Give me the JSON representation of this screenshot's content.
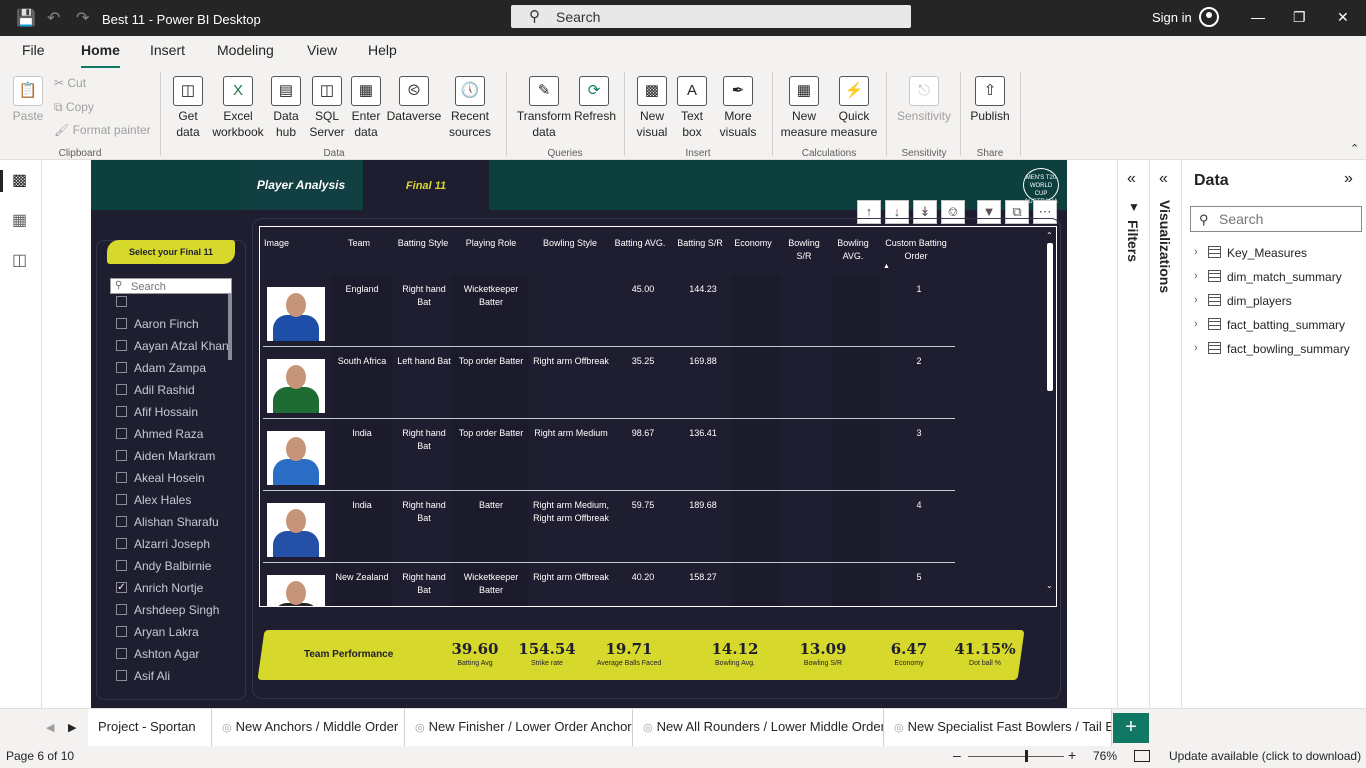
{
  "titlebar": {
    "title": "Best 11 - Power BI Desktop",
    "search_label": "Search",
    "signin_label": "Sign in"
  },
  "menu": [
    "File",
    "Home",
    "Insert",
    "Modeling",
    "View",
    "Help"
  ],
  "ribbon": {
    "clipboard": {
      "paste": "Paste",
      "cut": "Cut",
      "copy": "Copy",
      "format_painter": "Format painter",
      "group": "Clipboard"
    },
    "data": {
      "get_data": "Get data",
      "excel": "Excel workbook",
      "data_hub": "Data hub",
      "sql": "SQL Server",
      "enter": "Enter data",
      "dataverse": "Dataverse",
      "recent": "Recent sources",
      "group": "Data"
    },
    "queries": {
      "transform": "Transform data",
      "refresh": "Refresh",
      "group": "Queries"
    },
    "insert": {
      "new_visual": "New visual",
      "text_box": "Text box",
      "more_visuals": "More visuals",
      "group": "Insert"
    },
    "calculations": {
      "new_measure": "New measure",
      "quick_measure": "Quick measure",
      "group": "Calculations"
    },
    "sensitivity": {
      "label": "Sensitivity",
      "group": "Sensitivity"
    },
    "share": {
      "publish": "Publish",
      "group": "Share"
    }
  },
  "report": {
    "tabs": {
      "player_analysis": "Player Analysis",
      "final11": "Final 11"
    },
    "logo_text": "MEN'S T20 WORLD CUP AUSTRALIA 2022",
    "slicer": {
      "title": "Select your Final 11",
      "search_placeholder": "Search",
      "items": [
        {
          "name": "",
          "checked": false
        },
        {
          "name": "Aaron Finch",
          "checked": false
        },
        {
          "name": "Aayan Afzal Khan",
          "checked": false
        },
        {
          "name": "Adam Zampa",
          "checked": false
        },
        {
          "name": "Adil Rashid",
          "checked": false
        },
        {
          "name": "Afif Hossain",
          "checked": false
        },
        {
          "name": "Ahmed Raza",
          "checked": false
        },
        {
          "name": "Aiden Markram",
          "checked": false
        },
        {
          "name": "Akeal Hosein",
          "checked": false
        },
        {
          "name": "Alex Hales",
          "checked": false
        },
        {
          "name": "Alishan Sharafu",
          "checked": false
        },
        {
          "name": "Alzarri Joseph",
          "checked": false
        },
        {
          "name": "Andy Balbirnie",
          "checked": false
        },
        {
          "name": "Anrich Nortje",
          "checked": true
        },
        {
          "name": "Arshdeep Singh",
          "checked": false
        },
        {
          "name": "Aryan Lakra",
          "checked": false
        },
        {
          "name": "Ashton Agar",
          "checked": false
        },
        {
          "name": "Asif Ali",
          "checked": false
        }
      ]
    },
    "table": {
      "headers": [
        "Image",
        "Team",
        "Batting Style",
        "Playing Role",
        "Bowling Style",
        "Batting AVG.",
        "Batting S/R",
        "Economy",
        "Bowling S/R",
        "Bowling AVG.",
        "Custom Batting Order"
      ],
      "rows": [
        {
          "team": "England",
          "batting_style": "Right hand Bat",
          "role": "Wicketkeeper Batter",
          "bowling_style": "",
          "bat_avg": "45.00",
          "bat_sr": "144.23",
          "economy": "",
          "bowl_sr": "",
          "bowl_avg": "",
          "order": "1",
          "jersey": "#1d4fa8"
        },
        {
          "team": "South Africa",
          "batting_style": "Left hand Bat",
          "role": "Top order Batter",
          "bowling_style": "Right arm Offbreak",
          "bat_avg": "35.25",
          "bat_sr": "169.88",
          "economy": "",
          "bowl_sr": "",
          "bowl_avg": "",
          "order": "2",
          "jersey": "#1e6b33"
        },
        {
          "team": "India",
          "batting_style": "Right hand Bat",
          "role": "Top order Batter",
          "bowling_style": "Right arm Medium",
          "bat_avg": "98.67",
          "bat_sr": "136.41",
          "economy": "",
          "bowl_sr": "",
          "bowl_avg": "",
          "order": "3",
          "jersey": "#2b6cc4"
        },
        {
          "team": "India",
          "batting_style": "Right hand Bat",
          "role": "Batter",
          "bowling_style": "Right arm Medium, Right arm Offbreak",
          "bat_avg": "59.75",
          "bat_sr": "189.68",
          "economy": "",
          "bowl_sr": "",
          "bowl_avg": "",
          "order": "4",
          "jersey": "#2450a8"
        },
        {
          "team": "New Zealand",
          "batting_style": "Right hand Bat",
          "role": "Wicketkeeper Batter",
          "bowling_style": "Right arm Offbreak",
          "bat_avg": "40.20",
          "bat_sr": "158.27",
          "economy": "",
          "bowl_sr": "",
          "bowl_avg": "",
          "order": "5",
          "jersey": "#222222"
        }
      ]
    },
    "kpi": {
      "title": "Team Performance",
      "items": [
        {
          "value": "39.60",
          "label": "Batting Avg"
        },
        {
          "value": "154.54",
          "label": "Strike rate"
        },
        {
          "value": "19.71",
          "label": "Average Balls Faced"
        },
        {
          "value": "14.12",
          "label": "Bowling Avg."
        },
        {
          "value": "13.09",
          "label": "Bowling S/R"
        },
        {
          "value": "6.47",
          "label": "Economy"
        },
        {
          "value": "41.15%",
          "label": "Dot ball %"
        }
      ]
    }
  },
  "panes": {
    "filters": "Filters",
    "visualizations": "Visualizations",
    "data": {
      "title": "Data",
      "search_placeholder": "Search",
      "tables": [
        "Key_Measures",
        "dim_match_summary",
        "dim_players",
        "fact_batting_summary",
        "fact_bowling_summary"
      ]
    }
  },
  "pagetabs": [
    "Project - Sportan",
    "New Anchors / Middle Order",
    "New Finisher / Lower Order Anchor",
    "New All Rounders / Lower Middle Order",
    "New Specialist Fast Bowlers / Tail End"
  ],
  "status": {
    "page": "Page 6 of 10",
    "zoom": "76%",
    "update": "Update available (click to download)"
  },
  "colors": {
    "accent": "#117865",
    "report_bg": "#1e1e30",
    "highlight": "#d7d82c",
    "header_bg": "#0e3f3f"
  }
}
